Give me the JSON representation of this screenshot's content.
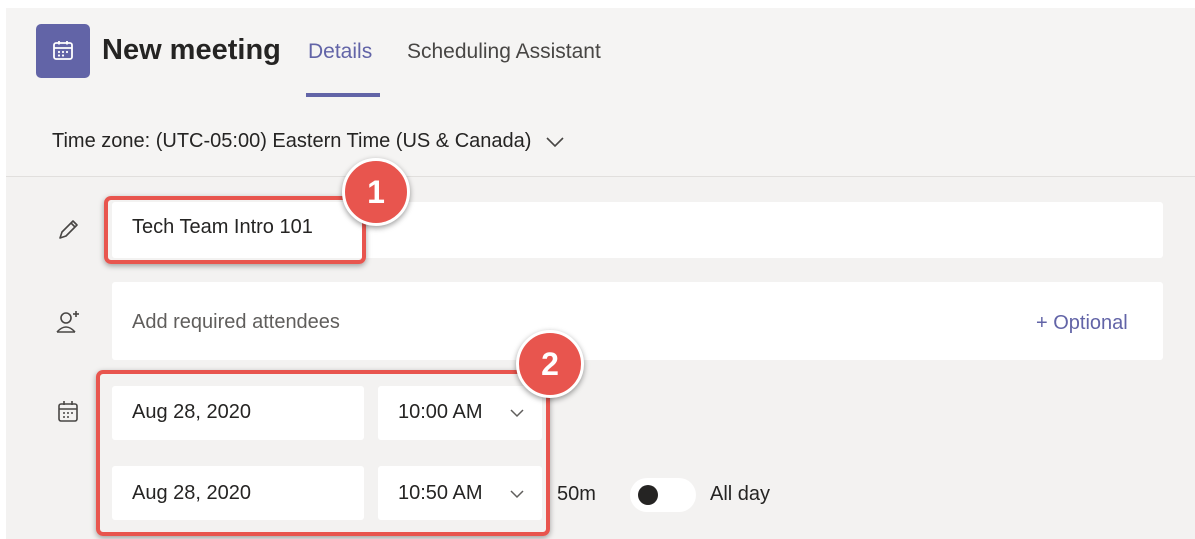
{
  "header": {
    "title": "New meeting",
    "tabs": [
      {
        "label": "Details",
        "active": true
      },
      {
        "label": "Scheduling Assistant",
        "active": false
      }
    ]
  },
  "timezone": {
    "label": "Time zone: (UTC-05:00) Eastern Time (US & Canada)"
  },
  "form": {
    "title_value": "Tech Team Intro 101",
    "attendees_placeholder": "Add required attendees",
    "optional_link": "+ Optional",
    "start_date": "Aug 28, 2020",
    "start_time": "10:00 AM",
    "end_date": "Aug 28, 2020",
    "end_time": "10:50 AM",
    "duration": "50m",
    "all_day_label": "All day",
    "all_day_on": false
  },
  "annotations": {
    "badge_1": "1",
    "badge_2": "2"
  },
  "colors": {
    "accent": "#6264a7",
    "annotation": "#e8554e"
  }
}
